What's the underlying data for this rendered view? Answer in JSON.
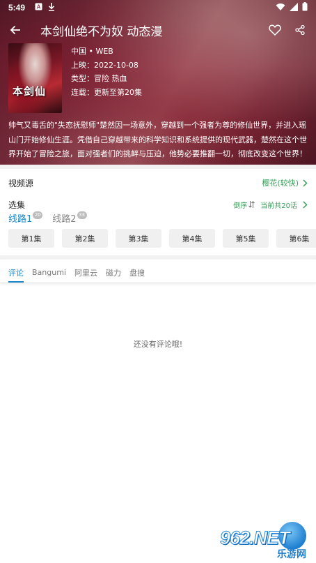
{
  "status_bar": {
    "time": "5:49",
    "notification_icons": [
      "a-icon",
      "download-icon"
    ],
    "right_icons": [
      "wifi-icon",
      "signal-icon",
      "battery-icon"
    ]
  },
  "toolbar": {
    "title": "本剑仙绝不为奴 动态漫"
  },
  "poster": {
    "text": "本剑仙"
  },
  "meta": {
    "region": "中国 • WEB",
    "release": "上映：2022-10-08",
    "genre": "类型：冒险 热血",
    "status": "连载：更新至第20集"
  },
  "description": "帅气又毒舌的\"失恋抚慰师\"楚然因一场意外，穿越到一个强者为尊的修仙世界，并进入瑶山门开始修仙生涯。凭借自己穿越带来的科学知识和系统提供的现代武器，楚然在这个世界开始了冒险之旅，面对强者们的挑衅与压迫，他势必要推翻一切，彻底改变这个世界！",
  "source": {
    "label": "视频源",
    "value": "樱花(较快)"
  },
  "episodes": {
    "label": "选集",
    "sort": "倒序",
    "total": "当前共20话",
    "lines": [
      {
        "label": "线路1",
        "count": "20",
        "active": true
      },
      {
        "label": "线路2",
        "count": "33",
        "active": false
      }
    ],
    "items": [
      "第1集",
      "第2集",
      "第3集",
      "第4集",
      "第5集",
      "第6集"
    ]
  },
  "tabs": [
    "评论",
    "Bangumi",
    "阿里云",
    "磁力",
    "盘搜"
  ],
  "empty_message": "还没有评论哦!",
  "watermark": {
    "logo": "962.NET",
    "sub": "乐游网"
  },
  "colors": {
    "accent_blue": "#1e88c8",
    "accent_green": "#3aa05a"
  }
}
